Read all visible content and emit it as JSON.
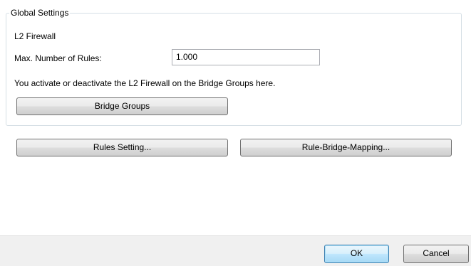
{
  "global_settings": {
    "title": "Global Settings",
    "section_label": "L2 Firewall",
    "max_rules_label": "Max. Number of Rules:",
    "max_rules_value": "1.000",
    "description": "You activate or deactivate the L2 Firewall on the Bridge Groups here.",
    "bridge_groups_button": "Bridge Groups"
  },
  "actions": {
    "rules_setting_button": "Rules Setting...",
    "rule_bridge_mapping_button": "Rule-Bridge-Mapping..."
  },
  "footer": {
    "ok_button": "OK",
    "cancel_button": "Cancel"
  },
  "colors": {
    "group_border": "#d5dfe5",
    "button_border": "#707070",
    "default_button_border": "#3c7fb1",
    "footer_background": "#f0f0f0"
  }
}
